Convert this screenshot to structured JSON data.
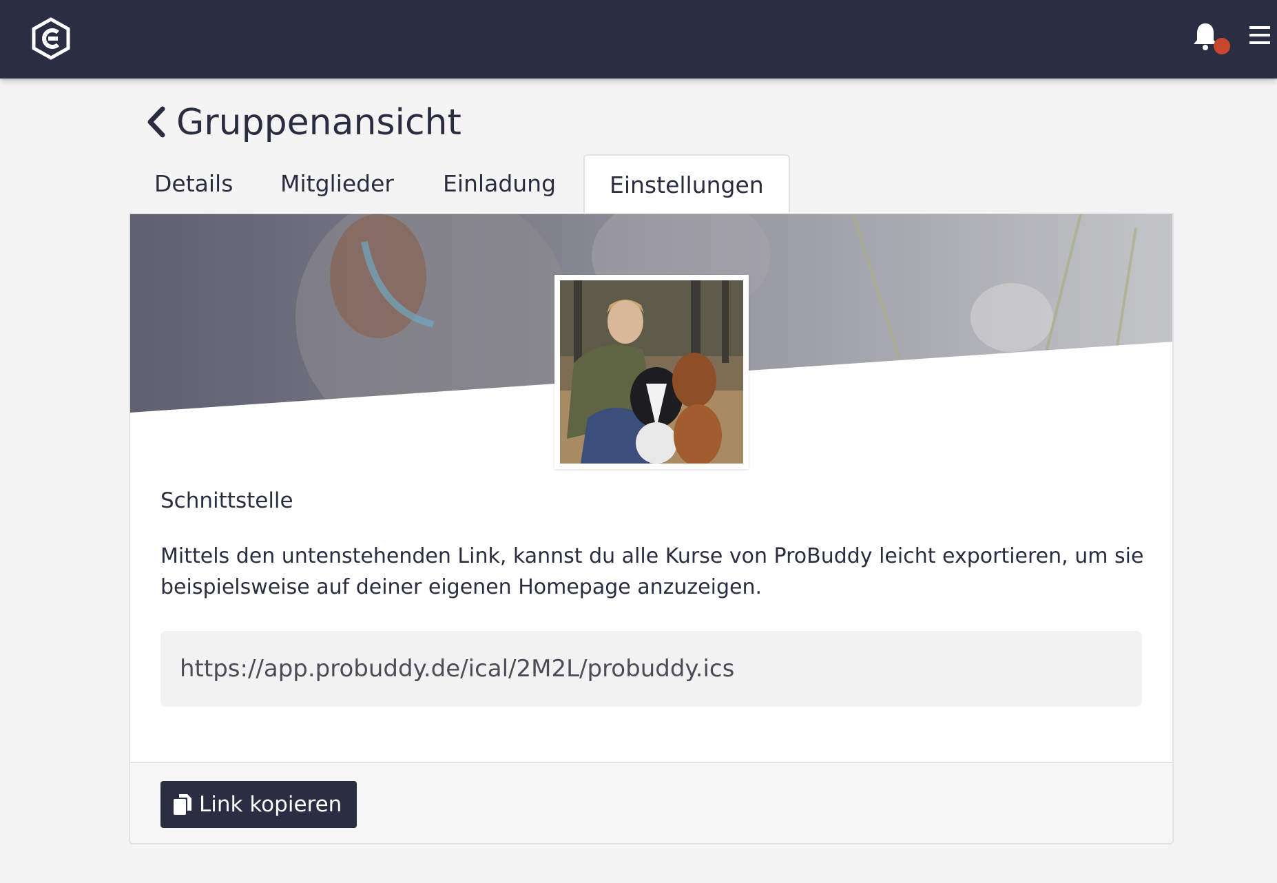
{
  "header": {
    "logo_icon": "probuddy-hexagon-logo",
    "notification_icon": "bell-icon",
    "notification_dot_color": "#c9472c",
    "menu_icon": "hamburger-icon",
    "background_color": "#2b2e42"
  },
  "page": {
    "back_icon": "chevron-left-icon",
    "title": "Gruppenansicht"
  },
  "tabs": [
    {
      "label": "Details",
      "active": false
    },
    {
      "label": "Mitglieder",
      "active": false
    },
    {
      "label": "Einladung",
      "active": false
    },
    {
      "label": "Einstellungen",
      "active": true
    }
  ],
  "settings": {
    "section_title": "Schnittstelle",
    "description": "Mittels den untenstehenden Link, kannst du alle Kurse von ProBuddy leicht exportieren, um sie beispielsweise auf deiner eigenen Homepage anzuzeigen.",
    "ical_link": "https://app.probuddy.de/ical/2M2L/probuddy.ics"
  },
  "footer": {
    "copy_icon": "copy-icon",
    "copy_label": "Link kopieren"
  }
}
